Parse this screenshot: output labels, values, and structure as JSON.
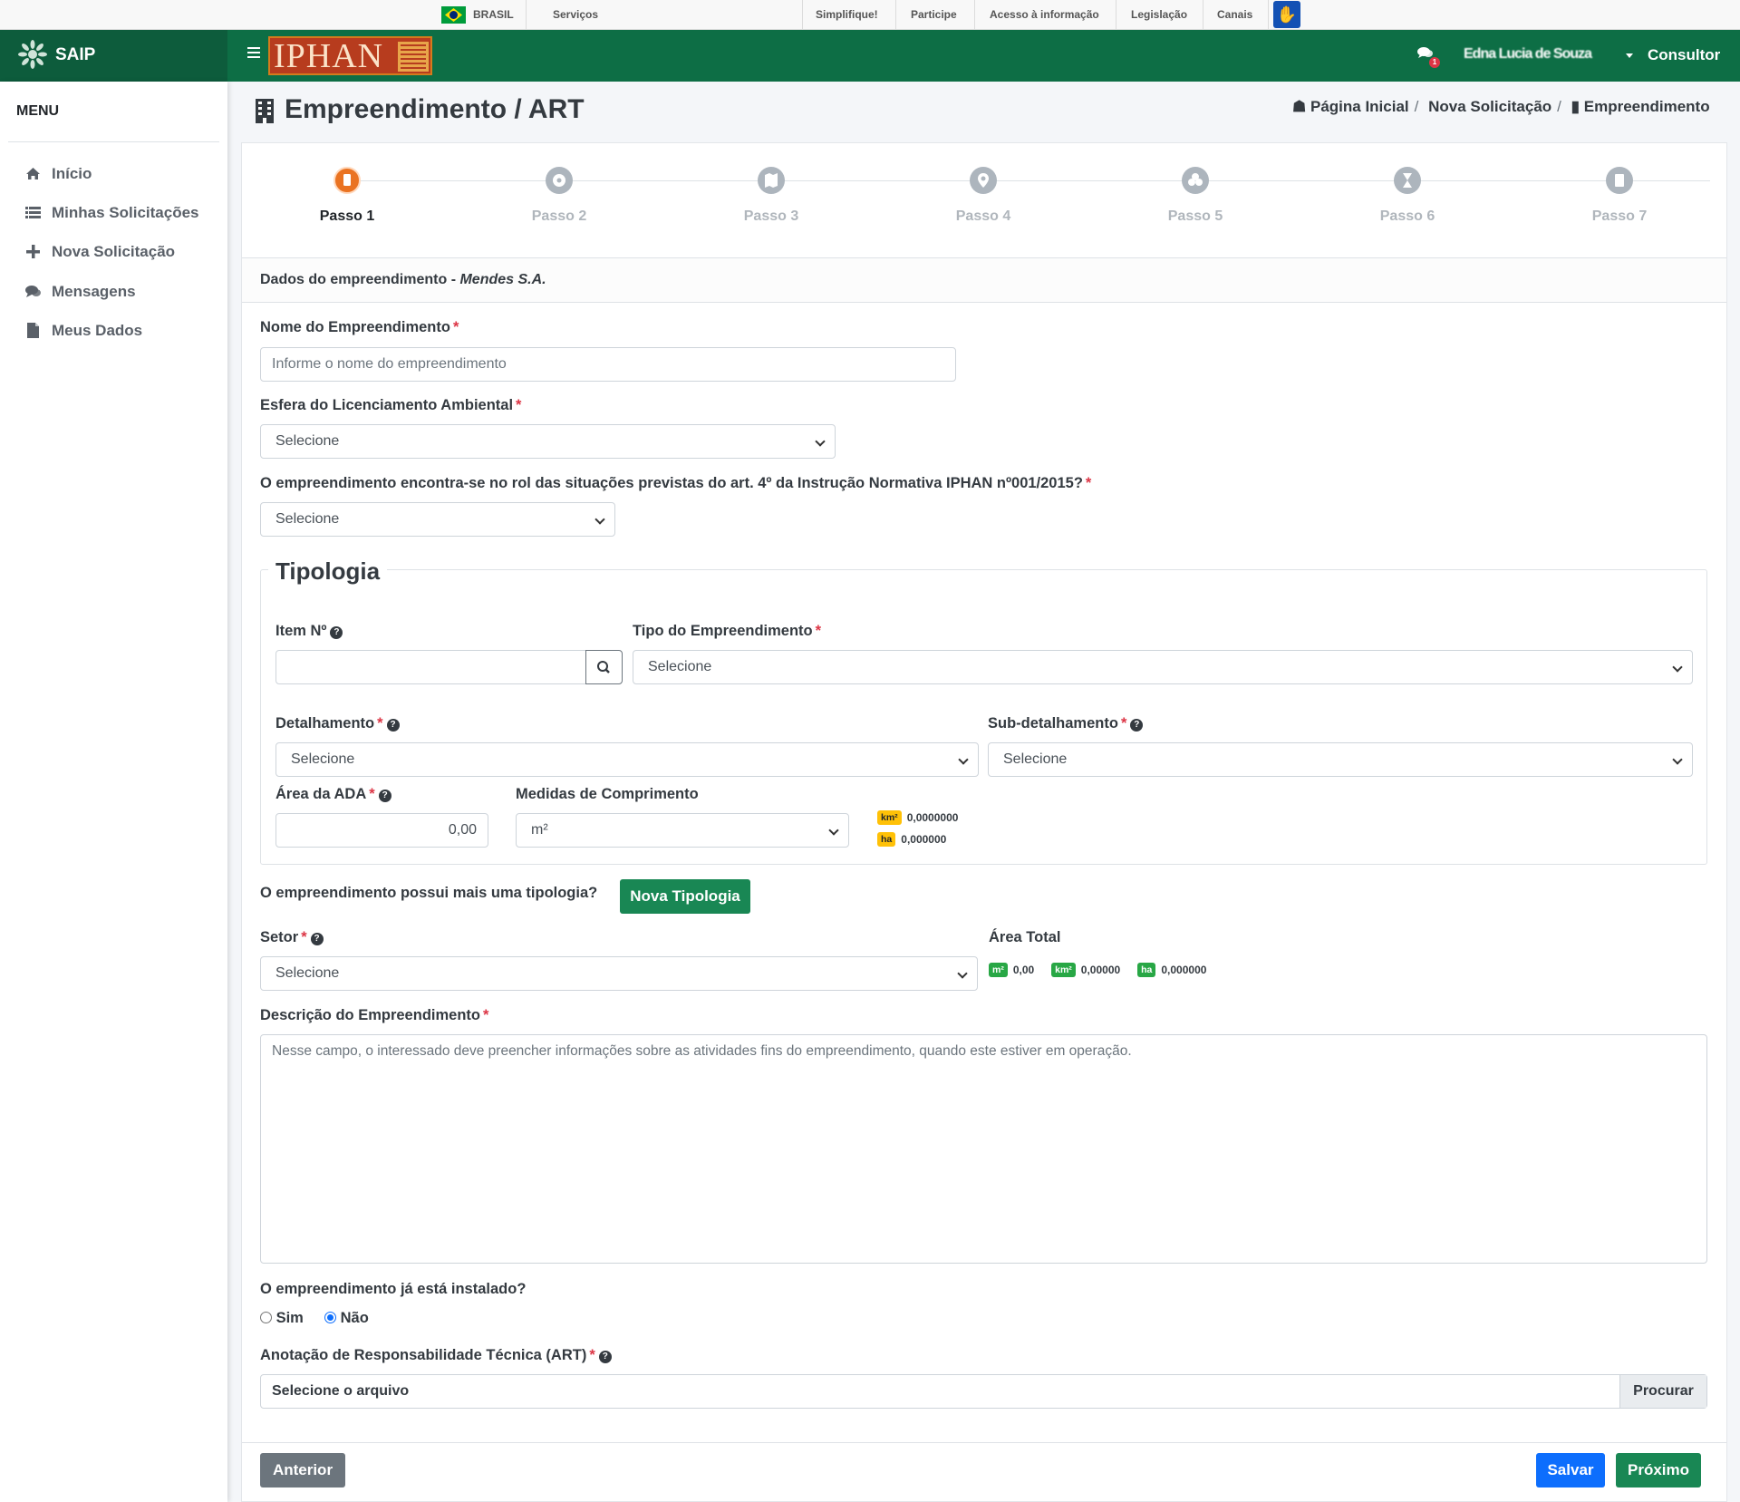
{
  "govbar": {
    "country": "BRASIL",
    "services": "Serviços",
    "links": [
      "Simplifique!",
      "Participe",
      "Acesso à informação",
      "Legislação",
      "Canais"
    ]
  },
  "app": {
    "name": "SAIP",
    "brand": "IPHAN"
  },
  "user": {
    "name": "Edna Lucia de Souza",
    "notifications": "1",
    "role": "Consultor"
  },
  "sidebar": {
    "title": "MENU",
    "items": [
      {
        "label": "Início",
        "icon": "home-icon"
      },
      {
        "label": "Minhas Solicitações",
        "icon": "list-icon"
      },
      {
        "label": "Nova Solicitação",
        "icon": "plus-icon"
      },
      {
        "label": "Mensagens",
        "icon": "comments-icon"
      },
      {
        "label": "Meus Dados",
        "icon": "file-icon"
      }
    ]
  },
  "page": {
    "title": "Empreendimento / ART",
    "breadcrumb": [
      "Página Inicial",
      "Nova Solicitação",
      "Empreendimento"
    ]
  },
  "steps": [
    "Passo 1",
    "Passo 2",
    "Passo 3",
    "Passo 4",
    "Passo 5",
    "Passo 6",
    "Passo 7"
  ],
  "active_step": 1,
  "form": {
    "section_title": "Dados do empreendimento - ",
    "company": "Mendes S.A.",
    "nome_label": "Nome do Empreendimento",
    "nome_placeholder": "Informe o nome do empreendimento",
    "esfera_label": "Esfera do Licenciamento Ambiental",
    "esfera_value": "Selecione",
    "rol_label": "O empreendimento encontra-se no rol das situações previstas do art. 4º da Instrução Normativa IPHAN nº001/2015?",
    "rol_value": "Selecione",
    "tipologia": {
      "legend": "Tipologia",
      "item_label": "Item Nº",
      "item_value": "",
      "tipo_label": "Tipo do Empreendimento",
      "tipo_value": "Selecione",
      "detalhamento_label": "Detalhamento",
      "detalhamento_value": "Selecione",
      "subdetalhamento_label": "Sub-detalhamento",
      "subdetalhamento_value": "Selecione",
      "area_label": "Área da ADA",
      "area_value": "0,00",
      "medidas_label": "Medidas de Comprimento",
      "medidas_value": "m²",
      "conv_km2_unit": "km²",
      "conv_km2_value": "0,0000000",
      "conv_ha_unit": "ha",
      "conv_ha_value": "0,000000"
    },
    "mais_tipologia_label": "O empreendimento possui mais uma tipologia?",
    "nova_tipologia_button": "Nova Tipologia",
    "setor_label": "Setor",
    "setor_value": "Selecione",
    "area_total_label": "Área Total",
    "area_total": [
      {
        "unit": "m²",
        "value": "0,00"
      },
      {
        "unit": "km²",
        "value": "0,00000"
      },
      {
        "unit": "ha",
        "value": "0,000000"
      }
    ],
    "descricao_label": "Descrição do Empreendimento",
    "descricao_placeholder": "Nesse campo, o interessado deve preencher informações sobre as atividades fins do empreendimento, quando este estiver em operação.",
    "instalado_label": "O empreendimento já está instalado?",
    "instalado_options": [
      "Sim",
      "Não"
    ],
    "instalado_selected": "Não",
    "art_label": "Anotação de Responsabilidade Técnica (ART)",
    "art_file_text": "Selecione o arquivo",
    "art_browse": "Procurar"
  },
  "actions": {
    "previous": "Anterior",
    "save": "Salvar",
    "next": "Próximo"
  },
  "colors": {
    "header": "#0d6e45",
    "brand_dark": "#0d5c3c",
    "active_step": "#ea7322",
    "primary": "#0d6efd",
    "success": "#198754",
    "required": "#dc3545",
    "warning": "#ffc107"
  }
}
